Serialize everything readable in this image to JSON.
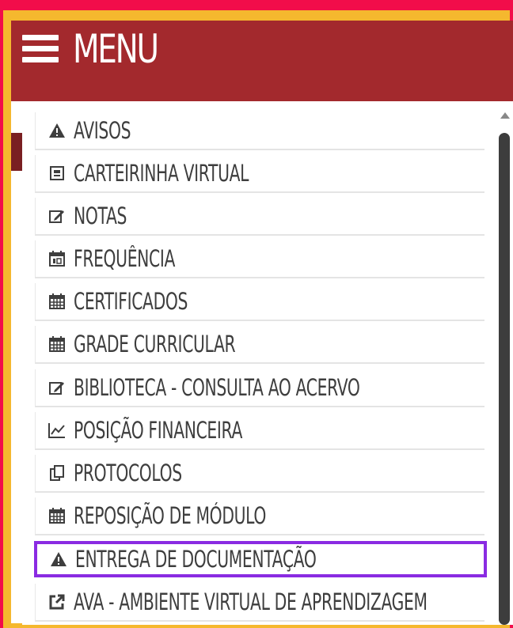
{
  "header": {
    "title": "MENU",
    "icon": "hamburger-icon",
    "background_color": "#a3292d"
  },
  "outer_border_color": "#f5b82e",
  "page_background": "#f20d4a",
  "highlight_color": "#8a2be2",
  "menu_items": [
    {
      "label": "AVISOS",
      "icon": "warning-icon"
    },
    {
      "label": "CARTEIRINHA VIRTUAL",
      "icon": "id-card-icon"
    },
    {
      "label": "NOTAS",
      "icon": "edit-icon"
    },
    {
      "label": "FREQUÊNCIA",
      "icon": "calendar-check-icon"
    },
    {
      "label": "CERTIFICADOS",
      "icon": "calendar-icon"
    },
    {
      "label": "GRADE CURRICULAR",
      "icon": "calendar-icon"
    },
    {
      "label": "BIBLIOTECA - CONSULTA AO ACERVO",
      "icon": "edit-icon"
    },
    {
      "label": "POSIÇÃO FINANCEIRA",
      "icon": "line-chart-icon"
    },
    {
      "label": "PROTOCOLOS",
      "icon": "clipboard-icon"
    },
    {
      "label": "REPOSIÇÃO DE MÓDULO",
      "icon": "calendar-icon"
    },
    {
      "label": "ENTREGA DE DOCUMENTAÇÃO",
      "icon": "warning-icon",
      "highlighted": true
    },
    {
      "label": "AVA - AMBIENTE VIRTUAL DE APRENDIZAGEM",
      "icon": "external-link-icon"
    }
  ]
}
